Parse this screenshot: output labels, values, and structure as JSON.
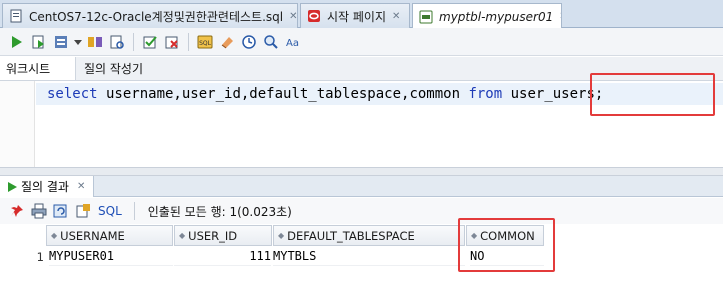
{
  "tabs": [
    {
      "label": "CentOS7-12c-Oracle계정및권한관련테스트.sql",
      "active": false,
      "icon": "sql-file-icon"
    },
    {
      "label": "시작 페이지",
      "active": false,
      "icon": "oracle-start-icon"
    },
    {
      "label": "myptbl-mypuser01",
      "active": true,
      "icon": "sql-worksheet-icon"
    }
  ],
  "close_glyph": "✕",
  "subtabs": [
    "워크시트",
    "질의 작성기"
  ],
  "editor": {
    "tokens": [
      {
        "text": "select",
        "type": "keyword"
      },
      {
        "text": " username,user_id,default_tablespace,common ",
        "type": "plain"
      },
      {
        "text": "from",
        "type": "keyword"
      },
      {
        "text": " ",
        "type": "plain"
      },
      {
        "text": "user_users;",
        "type": "plain"
      }
    ]
  },
  "result": {
    "tab_label": "질의 결과",
    "sql_link": "SQL",
    "status": "인출된 모든 행: 1(0.023초)",
    "columns": [
      "USERNAME",
      "USER_ID",
      "DEFAULT_TABLESPACE",
      "COMMON"
    ],
    "rows": [
      {
        "num": "1",
        "cells": [
          "MYPUSER01",
          "111",
          "MYTBLS",
          "NO"
        ]
      }
    ]
  },
  "colors": {
    "keyword": "#1d3bb7",
    "highlight_box": "#e33b3b",
    "tab_bar": "#d4e0ee"
  }
}
